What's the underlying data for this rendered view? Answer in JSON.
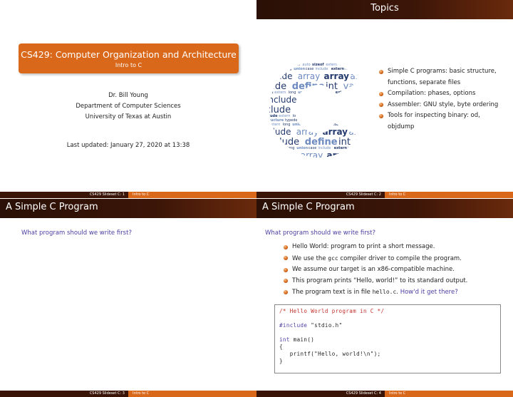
{
  "footer": {
    "s1": {
      "left": "CS429 Slideset C: 1",
      "right": "Intro to C"
    },
    "s2": {
      "left": "CS429 Slideset C: 2",
      "right": "Intro to C"
    },
    "s3": {
      "left": "CS429 Slideset C: 3",
      "right": "Intro to C"
    },
    "s4": {
      "left": "CS429 Slideset C: 4",
      "right": "Intro to C"
    }
  },
  "slide1": {
    "title": "CS429: Computer Organization and Architecture",
    "subtitle": "Intro to C",
    "author": "Dr. Bill Young",
    "dept": "Department of Computer Sciences",
    "univ": "University of Texas at Austin",
    "updated": "Last updated: January 27, 2020 at 13:38"
  },
  "slide2": {
    "title": "Topics",
    "bullets": [
      "Simple C programs: basic structure, functions, separate files",
      "Compilation: phases, options",
      "Assembler: GNU style, byte ordering",
      "Tools for inspecting binary: od, objdump"
    ],
    "colors": {
      "cloud_dark": "#243a6e",
      "cloud_light": "#6d8bc0"
    },
    "cloud_words": [
      "structure",
      "pointer",
      "function",
      "array",
      "return",
      "variable",
      "CHARACTER",
      "define",
      "operator",
      "string",
      "include",
      "typedef",
      "sizeof",
      "case",
      "union",
      "extern",
      "auto",
      "long",
      "int",
      "char"
    ]
  },
  "slide3": {
    "title": "A Simple C Program",
    "question": "What program should we write first?"
  },
  "slide4": {
    "title": "A Simple C Program",
    "question": "What program should we write first?",
    "bullets": {
      "b1": "Hello World: program to print a short message.",
      "b2_pre": "We use the ",
      "b2_code": "gcc",
      "b2_post": " compiler driver to compile the program.",
      "b3": "We assume our target is an x86-compatible machine.",
      "b4": "This program prints “Hello, world!” to its standard output.",
      "b5_pre": "The program text is in file ",
      "b5_code": "hello.c",
      "b5_post": ". ",
      "b5_ask": "How'd it get there?"
    },
    "code": {
      "comment": "/* Hello World program in C */",
      "include_kw": "#include",
      "include_arg": " \"stdio.h\"",
      "int_kw": "int",
      "main_rest": " main()",
      "open": "{",
      "printf": "   printf(\"Hello, world!\\n\");",
      "close": "}"
    }
  }
}
